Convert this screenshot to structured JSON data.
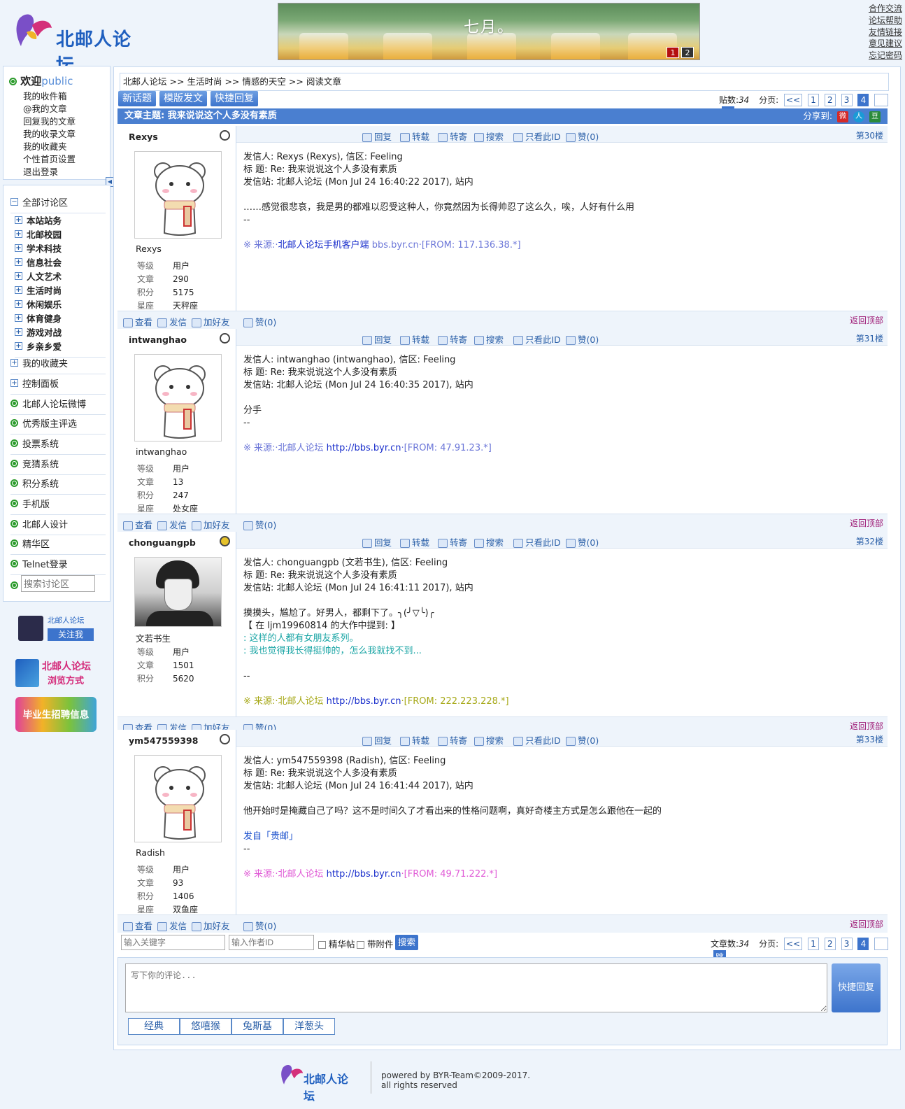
{
  "header": {
    "logo_text": "北邮人论坛",
    "banner_text": "七月。",
    "banner_pages": [
      "1",
      "2"
    ],
    "top_links": [
      "合作交流",
      "论坛帮助",
      "友情链接",
      "意见建议",
      "忘记密码"
    ]
  },
  "welcome": {
    "title": "欢迎",
    "user": "public",
    "items": [
      "我的收件箱",
      "@我的文章",
      "回复我的文章",
      "我的收录文章",
      "我的收藏夹",
      "个性首页设置",
      "退出登录"
    ]
  },
  "nav": {
    "all_boards": "全部讨论区",
    "sections": [
      "本站站务",
      "北邮校园",
      "学术科技",
      "信息社会",
      "人文艺术",
      "生活时尚",
      "休闲娱乐",
      "体育健身",
      "游戏对战",
      "乡亲乡爱"
    ],
    "favorites": "我的收藏夹",
    "control": "控制面板",
    "links": [
      "北邮人论坛微博",
      "优秀版主评选",
      "投票系统",
      "竞猜系统",
      "积分系统",
      "手机版",
      "北邮人设计",
      "精华区",
      "Telnet登录"
    ],
    "search_placeholder": "搜索讨论区"
  },
  "side_promos": {
    "weibo_name": "北邮人论坛",
    "weibo_follow": "关注我",
    "browse_title": "北邮人论坛",
    "browse_sub": "浏览方式",
    "jobs": "毕业生招聘信息"
  },
  "breadcrumb": [
    "北邮人论坛",
    "生活时尚",
    "情感的天空",
    "阅读文章"
  ],
  "breadcrumb_sep": ">>",
  "toolbar": {
    "new_topic": "新话题",
    "template": "模版发文",
    "quick_reply": "快捷回复",
    "post_count_label": "贴数:",
    "post_count": "34",
    "page_label": "分页:",
    "prev": "<<",
    "pages": [
      "1",
      "2",
      "3",
      "4"
    ],
    "go": "跳"
  },
  "subject": {
    "label": "文章主题:",
    "title": "我来说说这个人多没有素质",
    "share_label": "分享到:"
  },
  "actions": [
    "回复",
    "转载",
    "转寄",
    "搜索",
    "只看此ID",
    "赞(0)"
  ],
  "user_actions": [
    "查看",
    "发信",
    "加好友"
  ],
  "like_label": "赞(0)",
  "back_top": "返回顶部",
  "stat_labels": [
    "等级",
    "文章",
    "积分",
    "星座"
  ],
  "posts": [
    {
      "uid": "Rexys",
      "nick": "Rexys",
      "floor": "第30楼",
      "stats": [
        "用户",
        "290",
        "5175",
        "天秤座"
      ],
      "lines": [
        "发信人: Rexys (Rexys), 信区: Feeling",
        "标  题: Re: 我来说说这个人多没有素质",
        "发信站: 北邮人论坛 (Mon Jul 24 16:40:22 2017), 站内",
        "",
        "……感觉很悲哀，我是男的都难以忍受这种人，你竟然因为长得帅忍了这么久，唉，人好有什么用",
        "--",
        ""
      ],
      "source_pre": "※ 来源:·",
      "source_link": "北邮人论坛手机客户端",
      "source_post": " bbs.byr.cn·[FROM: 117.136.38.*]",
      "source_color": "#6b76d8"
    },
    {
      "uid": "intwanghao",
      "nick": "intwanghao",
      "floor": "第31楼",
      "stats": [
        "用户",
        "13",
        "247",
        "处女座"
      ],
      "lines": [
        "发信人: intwanghao (intwanghao), 信区: Feeling",
        "标  题: Re: 我来说说这个人多没有素质",
        "发信站: 北邮人论坛 (Mon Jul 24 16:40:35 2017), 站内",
        "",
        "分手",
        "--",
        ""
      ],
      "source_pre": "※ 来源:·北邮人论坛 ",
      "source_link": "http://bbs.byr.cn",
      "source_post": "·[FROM: 47.91.23.*]",
      "source_color": "#6b76d8"
    },
    {
      "uid": "chonguangpb",
      "nick": "文若书生",
      "floor": "第32楼",
      "stats": [
        "用户",
        "1501",
        "5620",
        ""
      ],
      "lines": [
        "发信人: chonguangpb (文若书生), 信区: Feeling",
        "标  题: Re: 我来说说这个人多没有素质",
        "发信站: 北邮人论坛 (Mon Jul 24 16:41:11 2017), 站内",
        "",
        "摸摸头，尴尬了。好男人，都剩下了。╮(╯▽╰)╭",
        "【 在 ljm19960814 的大作中提到: 】"
      ],
      "quotes": [
        ": 这样的人都有女朋友系列。",
        ": 我也觉得我长得挺帅的，怎么我就找不到..."
      ],
      "tail": [
        "",
        "--",
        ""
      ],
      "source_pre": "※ 来源:·北邮人论坛 ",
      "source_link": "http://bbs.byr.cn",
      "source_post": "·[FROM: 222.223.228.*]",
      "source_color": "#a6a817"
    },
    {
      "uid": "ym547559398",
      "nick": "Radish",
      "floor": "第33楼",
      "stats": [
        "用户",
        "93",
        "1406",
        "双鱼座"
      ],
      "lines": [
        "发信人: ym547559398 (Radish), 信区: Feeling",
        "标  题: Re: 我来说说这个人多没有素质",
        "发信站: 北邮人论坛 (Mon Jul 24 16:41:44 2017), 站内",
        "",
        "他开始时是掩藏自己了吗？这不是时间久了才看出来的性格问题啊，真好奇楼主方式是怎么跟他在一起的",
        ""
      ],
      "sent_from": "发自「贵邮」",
      "tail": [
        "--",
        ""
      ],
      "source_pre": "※ 来源:·北邮人论坛 ",
      "source_link": "http://bbs.byr.cn",
      "source_post": "·[FROM: 49.71.222.*]",
      "source_color": "#e05ad6"
    }
  ],
  "bottom_search": {
    "keyword_placeholder": "输入关键字",
    "author_placeholder": "输入作者ID",
    "digest": "精华帖",
    "attachment": "带附件",
    "search_button": "搜索",
    "article_count_label": "文章数:",
    "article_count": "34"
  },
  "reply": {
    "placeholder": "写下你的评论...",
    "submit": "快捷回复",
    "emoticons": [
      "经典",
      "悠嘻猴",
      "兔斯基",
      "洋葱头"
    ]
  },
  "footer": {
    "logo_text": "北邮人论坛",
    "powered": "powered by BYR-Team©2009-2017.",
    "rights": "all rights reserved"
  },
  "colors": {
    "accent": "#4a7fd0",
    "quote": "#1aa5a5",
    "top_link": "#a0207a"
  }
}
